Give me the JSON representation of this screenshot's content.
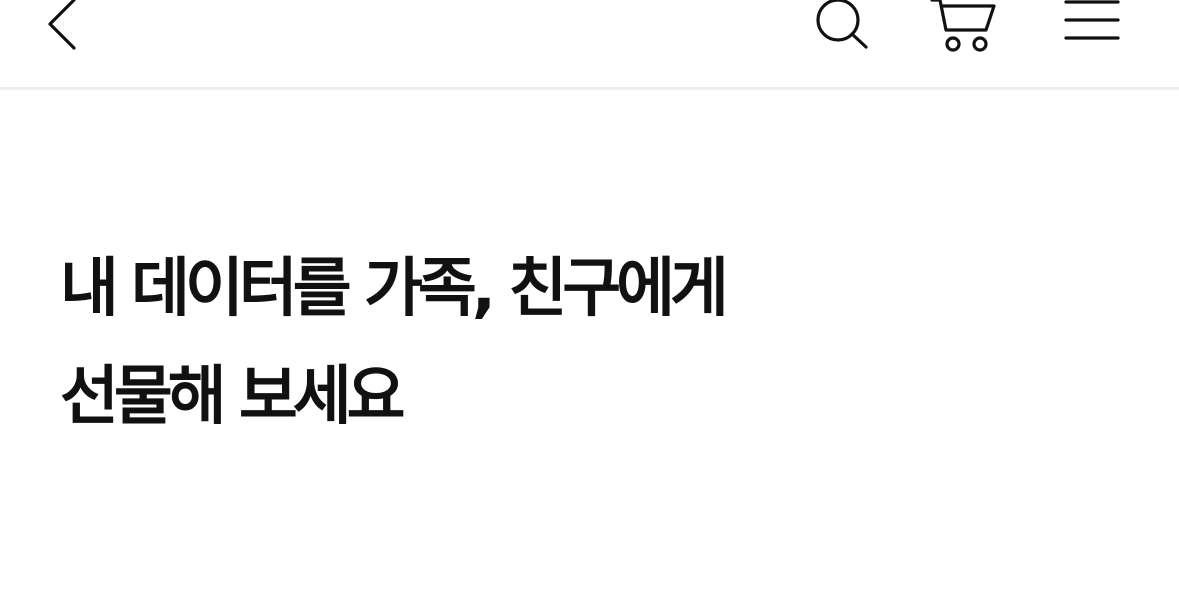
{
  "header": {
    "icons": {
      "back": "chevron-left-icon",
      "search": "search-icon",
      "cart": "cart-icon",
      "menu": "hamburger-menu-icon"
    }
  },
  "main": {
    "title_line1": "내 데이터를 가족, 친구에게",
    "title_line2": "선물해 보세요"
  },
  "colors": {
    "text": "#111111",
    "background": "#ffffff",
    "divider": "#eeeeee"
  }
}
